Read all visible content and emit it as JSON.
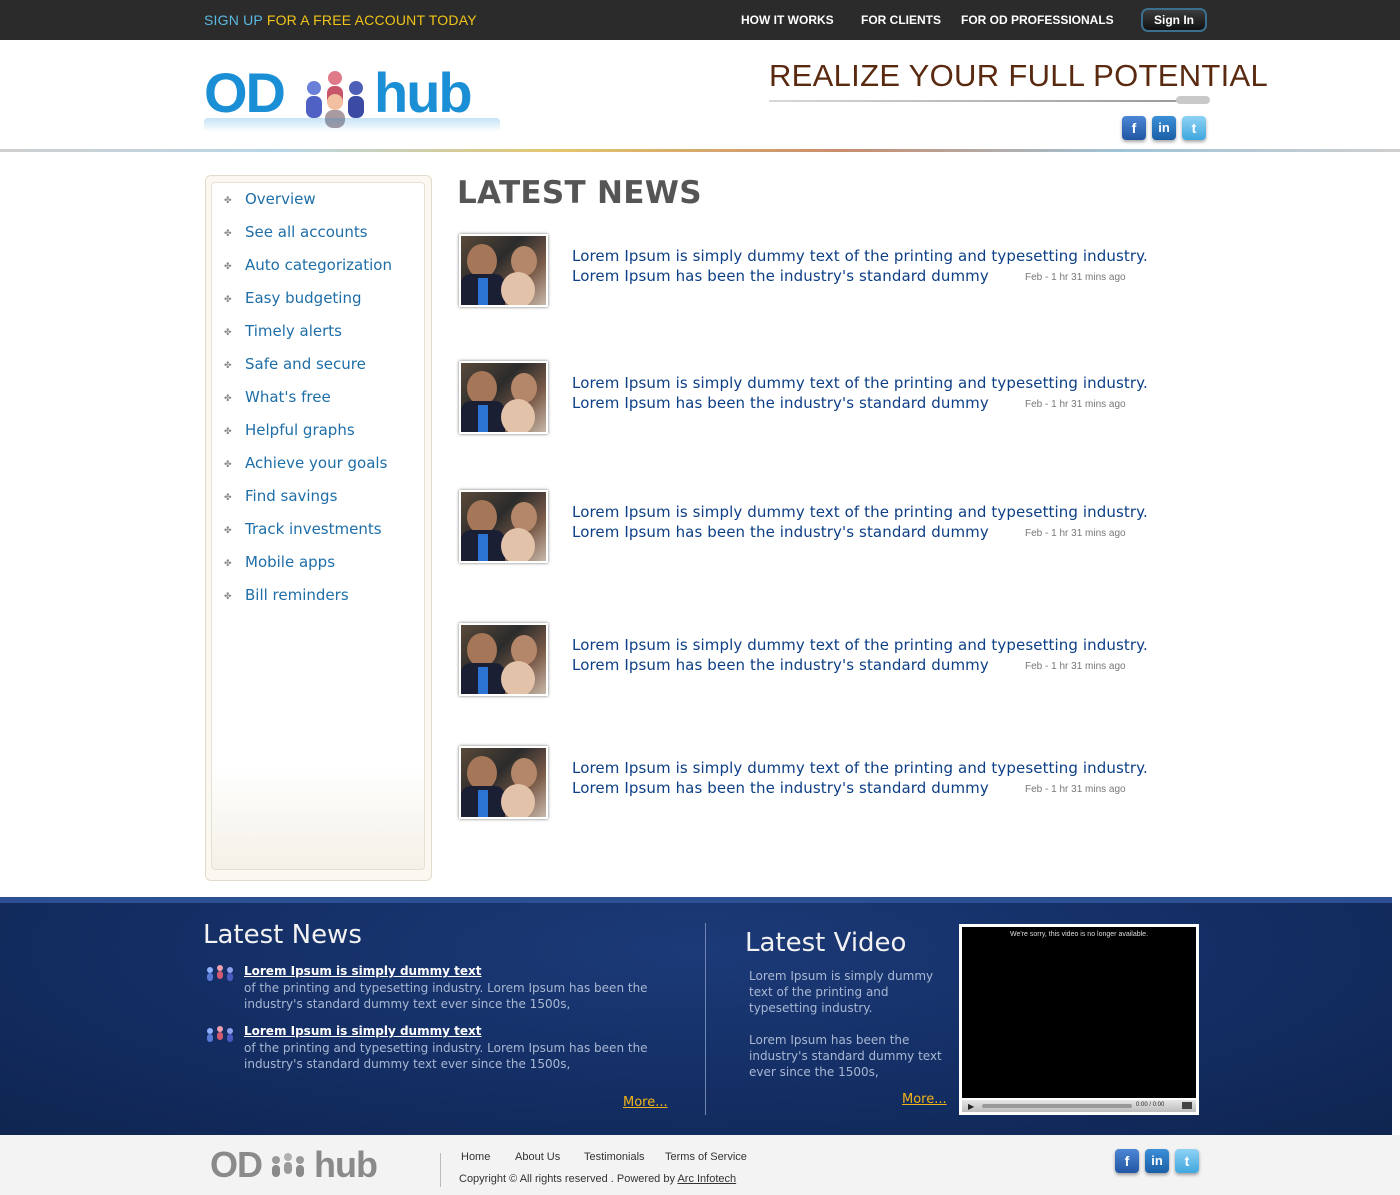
{
  "topbar": {
    "signup_a": "SIGN UP",
    "signup_b": "FOR A FREE ACCOUNT TODAY",
    "nav": [
      "HOW IT WORKS",
      "FOR CLIENTS",
      "FOR OD PROFESSIONALS"
    ],
    "signin": "Sign In"
  },
  "header": {
    "logo_od": "OD",
    "logo_hub": "hub",
    "tagline": "REALIZE YOUR FULL POTENTIAL",
    "social": [
      "f",
      "in",
      "t"
    ]
  },
  "sidebar": {
    "items": [
      "Overview",
      "See all accounts",
      "Auto categorization",
      "Easy budgeting",
      "Timely alerts",
      "Safe and secure",
      "What's free",
      "Helpful graphs",
      "Achieve your goals",
      "Find savings",
      "Track investments",
      "Mobile apps",
      "Bill reminders"
    ],
    "bullet": "✤"
  },
  "main": {
    "title": "LATEST NEWS",
    "news": [
      {
        "line1": "Lorem Ipsum is simply dummy text of the printing and typesetting industry.",
        "line2": "Lorem Ipsum has been the industry's standard dummy",
        "date": "Feb - 1 hr 31 mins ago"
      },
      {
        "line1": "Lorem Ipsum is simply dummy text of the printing and typesetting industry.",
        "line2": "Lorem Ipsum has been the industry's standard dummy",
        "date": "Feb - 1 hr 31 mins ago"
      },
      {
        "line1": "Lorem Ipsum is simply dummy text of the printing and typesetting industry.",
        "line2": "Lorem Ipsum has been the industry's standard dummy",
        "date": "Feb - 1 hr 31 mins ago"
      },
      {
        "line1": "Lorem Ipsum is simply dummy text of the printing and typesetting industry.",
        "line2": "Lorem Ipsum has been the industry's standard dummy",
        "date": "Feb - 1 hr 31 mins ago"
      },
      {
        "line1": "Lorem Ipsum is simply dummy text of the printing and typesetting industry.",
        "line2": "Lorem Ipsum has been the industry's standard dummy",
        "date": "Feb - 1 hr 31 mins ago"
      }
    ]
  },
  "footer_band": {
    "news_title": "Latest News",
    "news": [
      {
        "link": "Lorem Ipsum is simply dummy text",
        "desc": "of the printing and typesetting industry. Lorem Ipsum has been the industry's standard dummy text ever since the 1500s,"
      },
      {
        "link": "Lorem Ipsum is simply dummy text",
        "desc": "of the printing and typesetting industry. Lorem Ipsum has been the industry's standard dummy text ever since the 1500s,"
      }
    ],
    "news_more": "More...",
    "video_title": "Latest Video",
    "video_desc_1": "Lorem Ipsum is simply dummy text of the printing and typesetting industry.",
    "video_desc_2": "Lorem Ipsum has been the industry's standard dummy text ever since the 1500s,",
    "video_more": "More...",
    "video_message": "We're sorry, this video is no longer available.",
    "video_time": "0:00 / 0:00"
  },
  "footer": {
    "logo_od": "OD",
    "logo_hub": "hub",
    "links": [
      "Home",
      "About Us",
      "Testimonials",
      "Terms of Service"
    ],
    "copyright": "Copyright ©   All rights reserved . Powered by",
    "powered_by": "Arc Infotech"
  },
  "colors": {
    "topbar": "#2b2b2b",
    "logo_blue": "#1a8fd6",
    "tagline": "#5a2a10",
    "link_blue": "#0d3f86",
    "band_blue": "#132d62",
    "more_gold": "#f0b418"
  }
}
